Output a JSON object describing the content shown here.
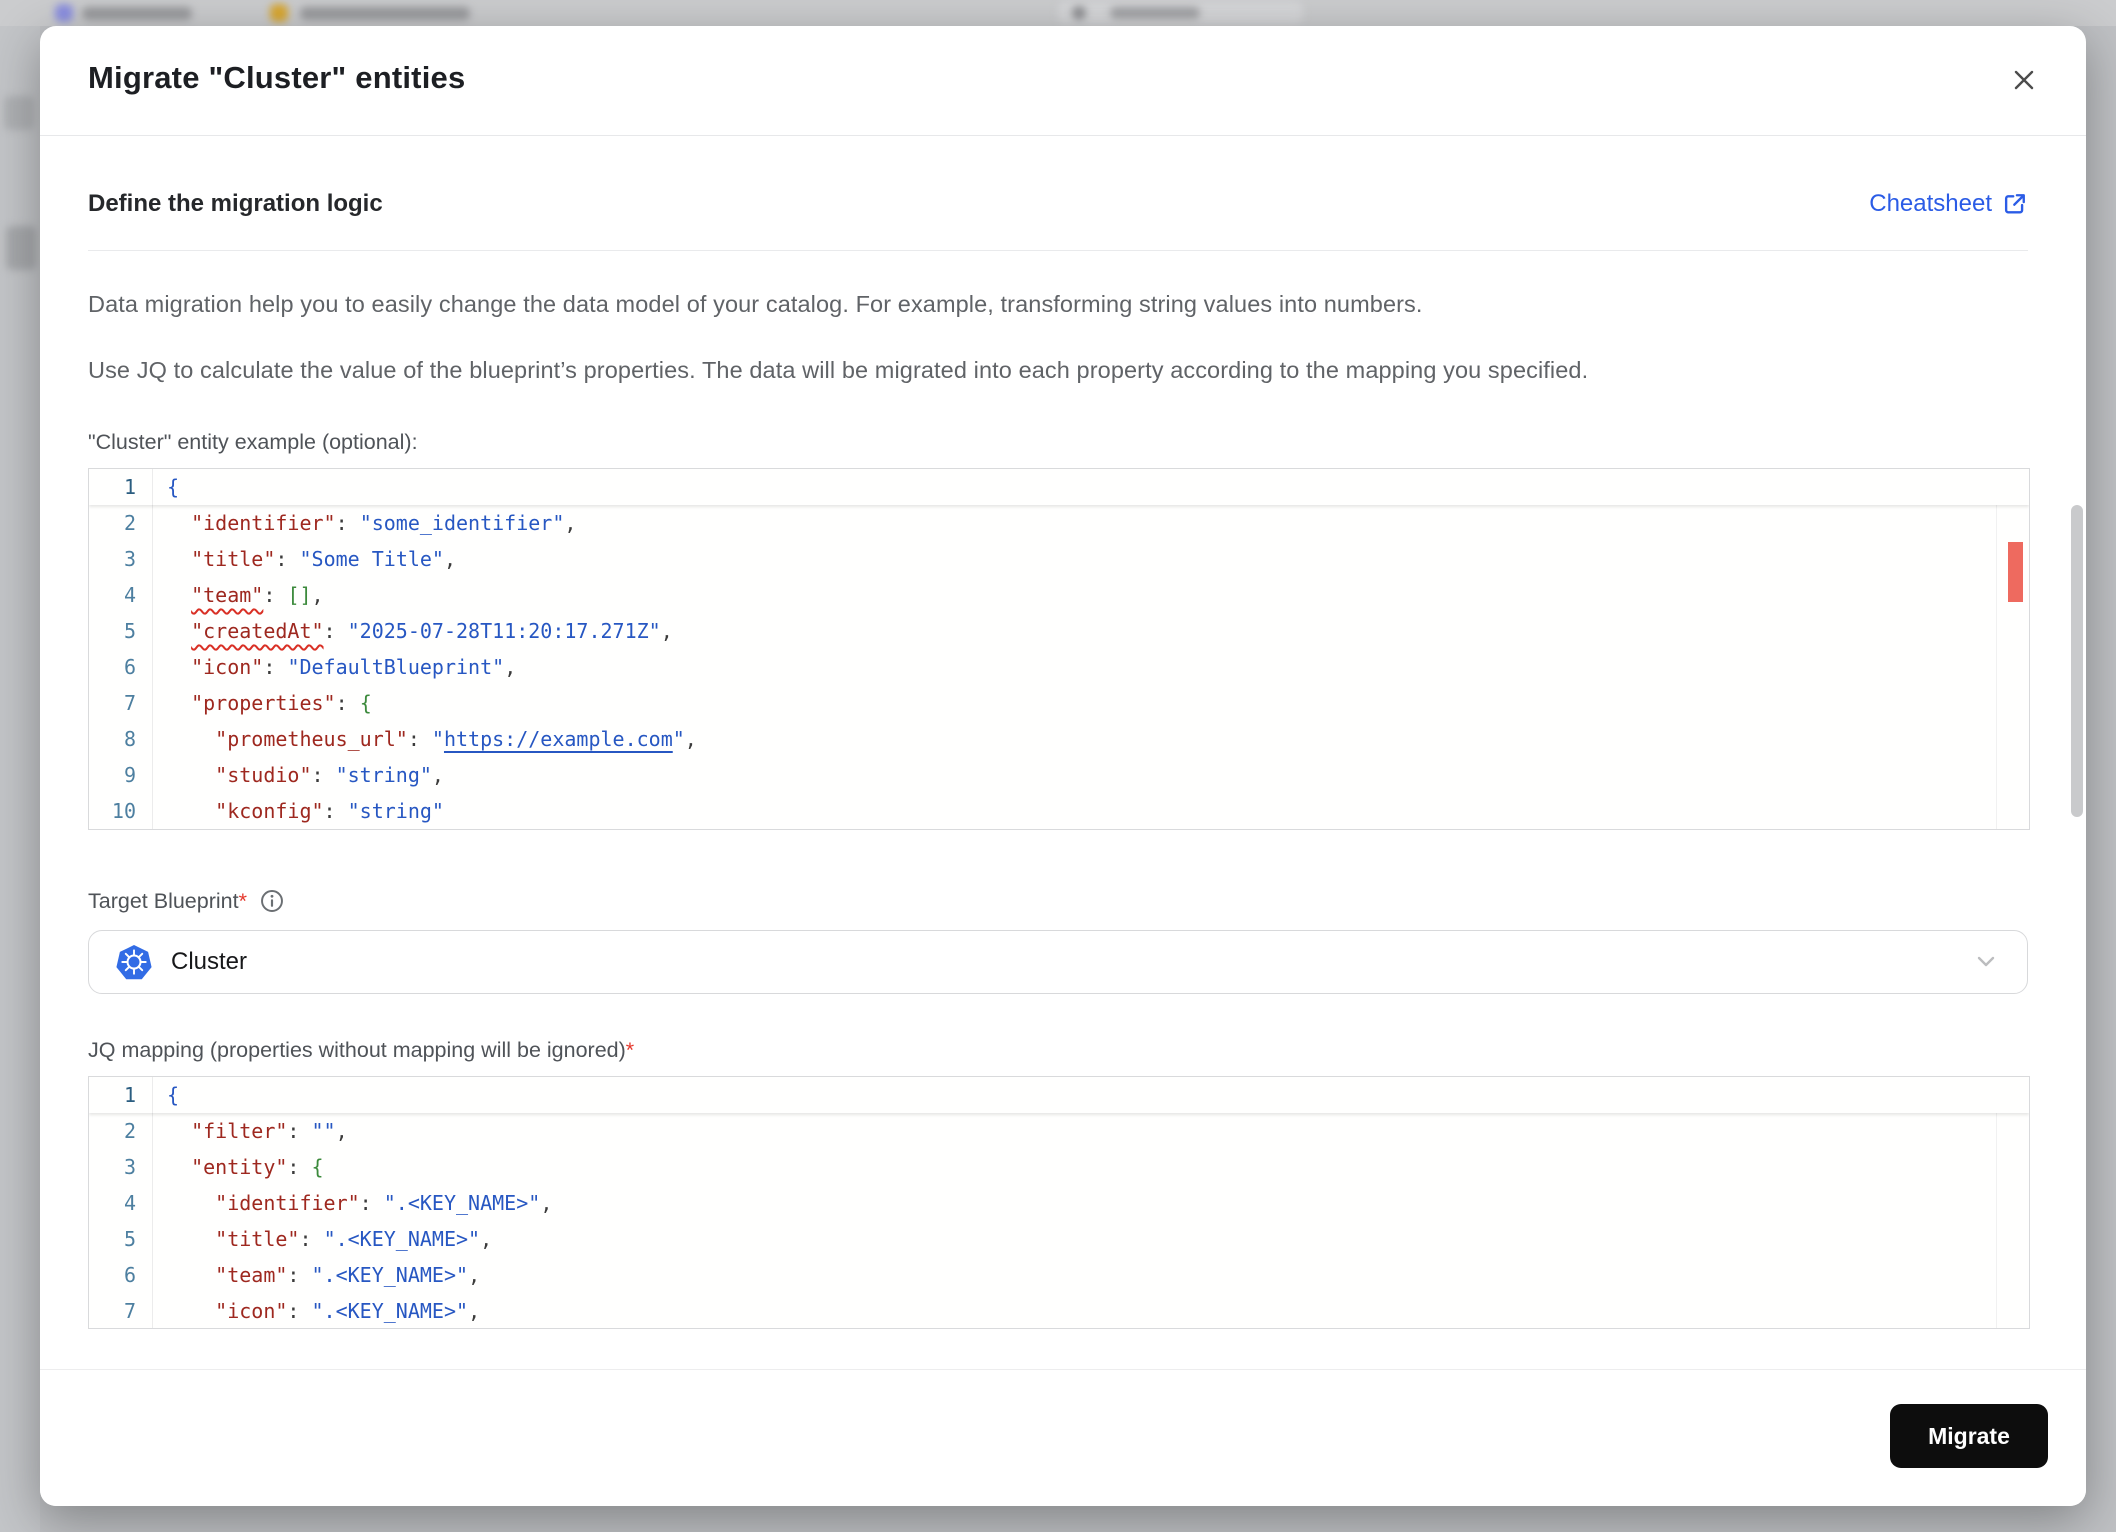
{
  "modal": {
    "title": "Migrate \"Cluster\" entities",
    "section_heading": "Define the migration logic",
    "cheatsheet_label": "Cheatsheet",
    "description_1": "Data migration help you to easily change the data model of your catalog. For example, transforming string values into numbers.",
    "description_2": "Use JQ to calculate the value of the blueprint’s properties. The data will be migrated into each property according to the mapping you specified.",
    "example_label": "\"Cluster\" entity example (optional):",
    "target_label": "Target Blueprint",
    "required_mark": "*",
    "target_value": "Cluster",
    "jq_label": "JQ mapping (properties without mapping will be ignored)",
    "migrate_label": "Migrate"
  },
  "colors": {
    "link_blue": "#2b5ce6",
    "button_black": "#0d0d0d",
    "required_red": "#e5372b",
    "error_marker": "#ee6a5f",
    "code_key": "#9e281f",
    "code_string": "#2757c2",
    "code_bracket_outer": "#2757c2",
    "code_bracket_inner": "#3c8a3c",
    "line_number": "#4d7fa0",
    "kubernetes_blue": "#326ce5"
  },
  "editors": [
    {
      "name": "entity-example-editor",
      "lines": [
        {
          "n": 1,
          "i": 0,
          "t": [
            [
              "b0",
              "{"
            ]
          ]
        },
        {
          "n": 2,
          "i": 1,
          "t": [
            [
              "k",
              "\"identifier\""
            ],
            [
              "p",
              ": "
            ],
            [
              "s",
              "\"some_identifier\""
            ],
            [
              "p",
              ","
            ]
          ]
        },
        {
          "n": 3,
          "i": 1,
          "t": [
            [
              "k",
              "\"title\""
            ],
            [
              "p",
              ": "
            ],
            [
              "s",
              "\"Some Title\""
            ],
            [
              "p",
              ","
            ]
          ]
        },
        {
          "n": 4,
          "i": 1,
          "t": [
            [
              "ks",
              "\"team\""
            ],
            [
              "p",
              ": "
            ],
            [
              "b1",
              "[]"
            ],
            [
              "p",
              ","
            ]
          ]
        },
        {
          "n": 5,
          "i": 1,
          "t": [
            [
              "ks",
              "\"createdAt\""
            ],
            [
              "p",
              ": "
            ],
            [
              "s",
              "\"2025-07-28T11:20:17.271Z\""
            ],
            [
              "p",
              ","
            ]
          ]
        },
        {
          "n": 6,
          "i": 1,
          "t": [
            [
              "k",
              "\"icon\""
            ],
            [
              "p",
              ": "
            ],
            [
              "s",
              "\"DefaultBlueprint\""
            ],
            [
              "p",
              ","
            ]
          ]
        },
        {
          "n": 7,
          "i": 1,
          "t": [
            [
              "k",
              "\"properties\""
            ],
            [
              "p",
              ": "
            ],
            [
              "b1",
              "{"
            ]
          ]
        },
        {
          "n": 8,
          "i": 2,
          "t": [
            [
              "k",
              "\"prometheus_url\""
            ],
            [
              "p",
              ": "
            ],
            [
              "s",
              "\""
            ],
            [
              "lnk",
              "https://example.com"
            ],
            [
              "s",
              "\""
            ],
            [
              "p",
              ","
            ]
          ]
        },
        {
          "n": 9,
          "i": 2,
          "t": [
            [
              "k",
              "\"studio\""
            ],
            [
              "p",
              ": "
            ],
            [
              "s",
              "\"string\""
            ],
            [
              "p",
              ","
            ]
          ]
        },
        {
          "n": 10,
          "i": 2,
          "t": [
            [
              "k",
              "\"kconfig\""
            ],
            [
              "p",
              ": "
            ],
            [
              "s",
              "\"string\""
            ]
          ]
        }
      ]
    },
    {
      "name": "jq-mapping-editor",
      "lines": [
        {
          "n": 1,
          "i": 0,
          "t": [
            [
              "b0",
              "{"
            ]
          ]
        },
        {
          "n": 2,
          "i": 1,
          "t": [
            [
              "k",
              "\"filter\""
            ],
            [
              "p",
              ": "
            ],
            [
              "s",
              "\"\""
            ],
            [
              "p",
              ","
            ]
          ]
        },
        {
          "n": 3,
          "i": 1,
          "t": [
            [
              "k",
              "\"entity\""
            ],
            [
              "p",
              ": "
            ],
            [
              "b1",
              "{"
            ]
          ]
        },
        {
          "n": 4,
          "i": 2,
          "t": [
            [
              "k",
              "\"identifier\""
            ],
            [
              "p",
              ": "
            ],
            [
              "s",
              "\".<KEY_NAME>\""
            ],
            [
              "p",
              ","
            ]
          ]
        },
        {
          "n": 5,
          "i": 2,
          "t": [
            [
              "k",
              "\"title\""
            ],
            [
              "p",
              ": "
            ],
            [
              "s",
              "\".<KEY_NAME>\""
            ],
            [
              "p",
              ","
            ]
          ]
        },
        {
          "n": 6,
          "i": 2,
          "t": [
            [
              "k",
              "\"team\""
            ],
            [
              "p",
              ": "
            ],
            [
              "s",
              "\".<KEY_NAME>\""
            ],
            [
              "p",
              ","
            ]
          ]
        },
        {
          "n": 7,
          "i": 2,
          "t": [
            [
              "k",
              "\"icon\""
            ],
            [
              "p",
              ": "
            ],
            [
              "s",
              "\".<KEY_NAME>\""
            ],
            [
              "p",
              ","
            ]
          ]
        }
      ]
    }
  ]
}
